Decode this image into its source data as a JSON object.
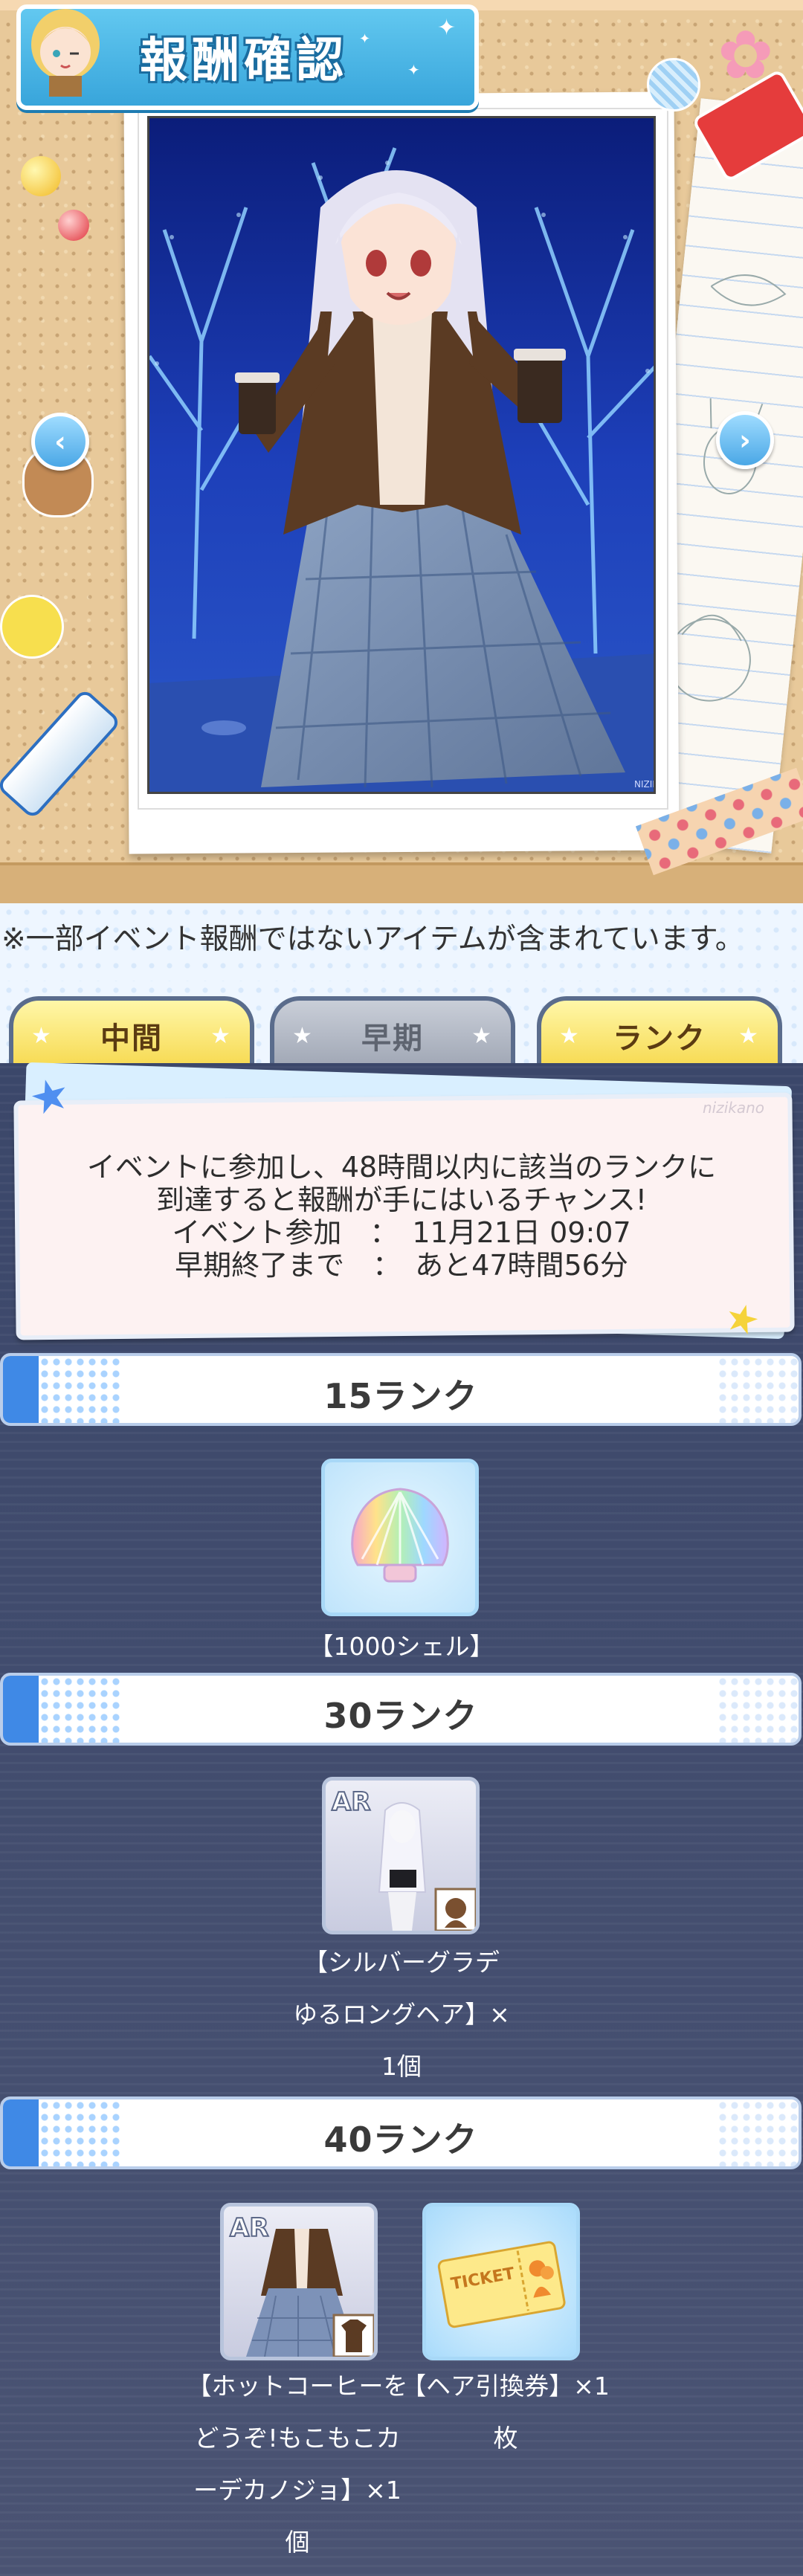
{
  "header": {
    "title": "報酬確認"
  },
  "notice": "※一部イベント報酬ではないアイテムが含まれています。",
  "tabs": [
    {
      "label": "中間",
      "active": true
    },
    {
      "label": "早期",
      "active": false
    },
    {
      "label": "ランク",
      "active": true
    }
  ],
  "info": {
    "line1": "イベントに参加し、48時間以内に該当のランクに",
    "line2": "到達すると報酬が手にはいるチャンス!",
    "line3": "イベント参加　：　11月21日 09:07",
    "line4": "早期終了まで　：　あと47時間56分",
    "brand": "nizikano"
  },
  "photo": {
    "credit": "NIZIKANO"
  },
  "ranks": [
    {
      "label": "15ランク",
      "rewards": [
        {
          "text": "【1000シェル】",
          "icon": "shell-icon"
        }
      ]
    },
    {
      "label": "30ランク",
      "rewards": [
        {
          "lines": [
            "【シルバーグラデ",
            "ゆるロングヘア】×",
            "1個"
          ],
          "icon": "hair-item-icon",
          "badge": "AR"
        }
      ]
    },
    {
      "label": "40ランク",
      "rewards": [
        {
          "lines": [
            "【ホットコーヒーを",
            "どうぞ!もこもこカ",
            "ーデカノジョ】×1",
            "個"
          ],
          "icon": "outfit-item-icon",
          "badge": "AR"
        },
        {
          "lines": [
            "【ヘア引換券】×1",
            "枚"
          ],
          "icon": "ticket-icon",
          "ticket_text": "TICKET"
        }
      ]
    }
  ],
  "colors": {
    "accent": "#3f89e6",
    "tab_active": "#f6d84c",
    "panel": "#3d4a6c"
  }
}
